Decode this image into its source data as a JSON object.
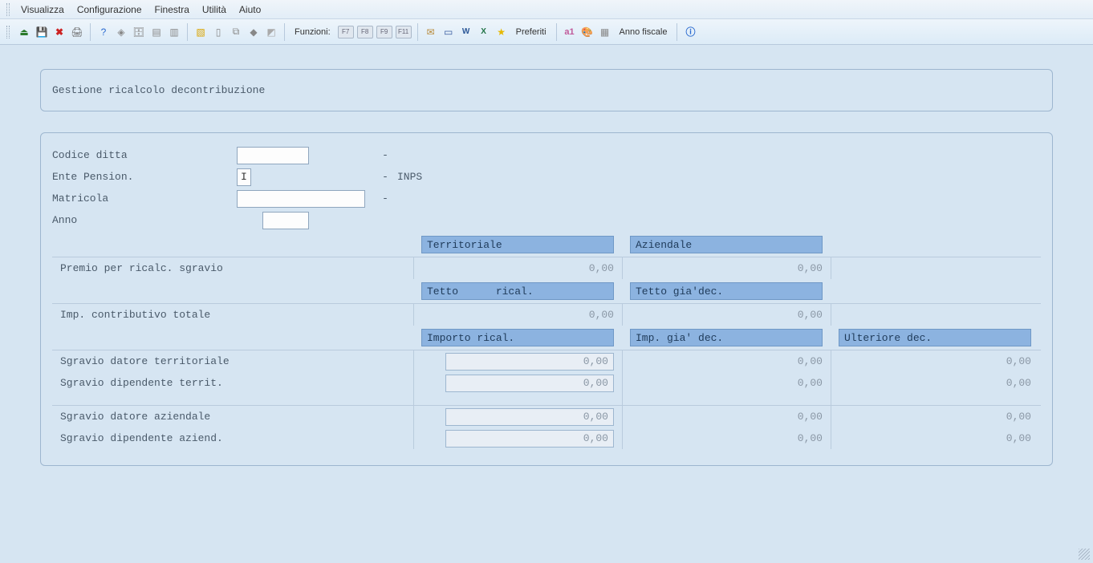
{
  "menu": {
    "visualizza": "Visualizza",
    "configurazione": "Configurazione",
    "finestra": "Finestra",
    "utilita": "Utilità",
    "aiuto": "Aiuto"
  },
  "toolbar": {
    "funzioni_label": "Funzioni:",
    "f7": "F7",
    "f8": "F8",
    "f9": "F9",
    "f11": "F11",
    "preferiti": "Preferiti",
    "anno_fiscale": "Anno fiscale"
  },
  "title": "Gestione ricalcolo decontribuzione",
  "header": {
    "codice_ditta_label": "Codice ditta",
    "codice_ditta_value": "",
    "codice_ditta_dash": "-",
    "ente_label": "Ente Pension.",
    "ente_value": "I",
    "ente_dash": "-",
    "ente_text": "INPS",
    "matricola_label": "Matricola",
    "matricola_value": "",
    "matricola_dash": "-",
    "anno_label": "Anno",
    "anno_value": ""
  },
  "cols": {
    "territoriale": "Territoriale",
    "aziendale": "Aziendale",
    "tetto_rical": "Tetto      rical.",
    "tetto_gia_dec": "Tetto gia'dec.",
    "importo_rical": "Importo rical.",
    "imp_gia_dec": "Imp. gia' dec.",
    "ulteriore_dec": "Ulteriore dec."
  },
  "rows": {
    "premio": "Premio per ricalc. sgravio",
    "imp_contrib": "Imp. contributivo totale",
    "sgr_datore_terr": "Sgravio datore territoriale",
    "sgr_dip_terr": "Sgravio dipendente territ.",
    "sgr_datore_az": "Sgravio datore aziendale",
    "sgr_dip_az": "Sgravio dipendente aziend."
  },
  "vals": {
    "zero": "0,00"
  }
}
